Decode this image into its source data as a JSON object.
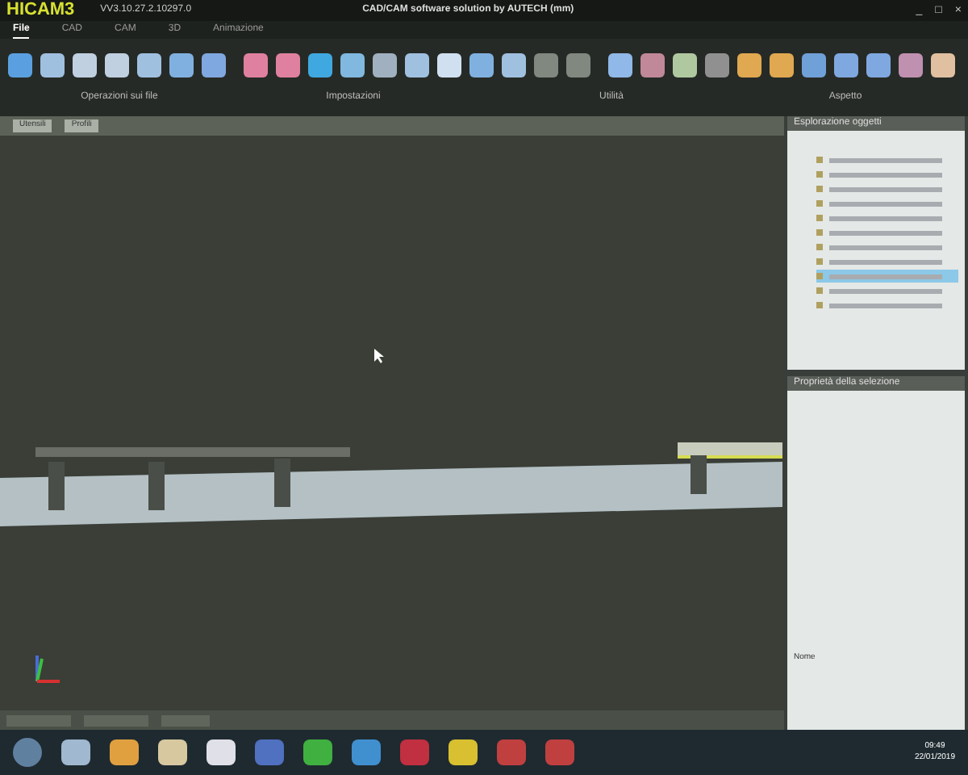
{
  "window": {
    "logo": "HICAM3",
    "version": "VV3.10.27.2.10297.0",
    "title": "CAD/CAM software solution by AUTECH (mm)",
    "controls": [
      "_",
      "□",
      "×"
    ]
  },
  "menu": [
    {
      "label": "File",
      "selected": true
    },
    {
      "label": "CAD",
      "selected": false
    },
    {
      "label": "CAM",
      "selected": false
    },
    {
      "label": "3D",
      "selected": false
    },
    {
      "label": "Animazione",
      "selected": false
    }
  ],
  "toolbar_groups": [
    "Operazioni sui file",
    "Impostazioni",
    "Utilità",
    "Aspetto"
  ],
  "doc_tabs": [
    {
      "label": "Utensili",
      "selected": false
    },
    {
      "label": "Profili",
      "selected": false
    }
  ],
  "explorer": {
    "title": "Esplorazione oggetti",
    "rows": [
      {
        "selected": false
      },
      {
        "selected": false
      },
      {
        "selected": false
      },
      {
        "selected": false
      },
      {
        "selected": false
      },
      {
        "selected": false
      },
      {
        "selected": false
      },
      {
        "selected": false
      },
      {
        "selected": true
      },
      {
        "selected": false
      },
      {
        "selected": false
      }
    ]
  },
  "properties": {
    "title": "Proprietà della selezione",
    "note": "Nome"
  },
  "taskbar": {
    "time": "09:49",
    "date": "22/01/2019"
  }
}
